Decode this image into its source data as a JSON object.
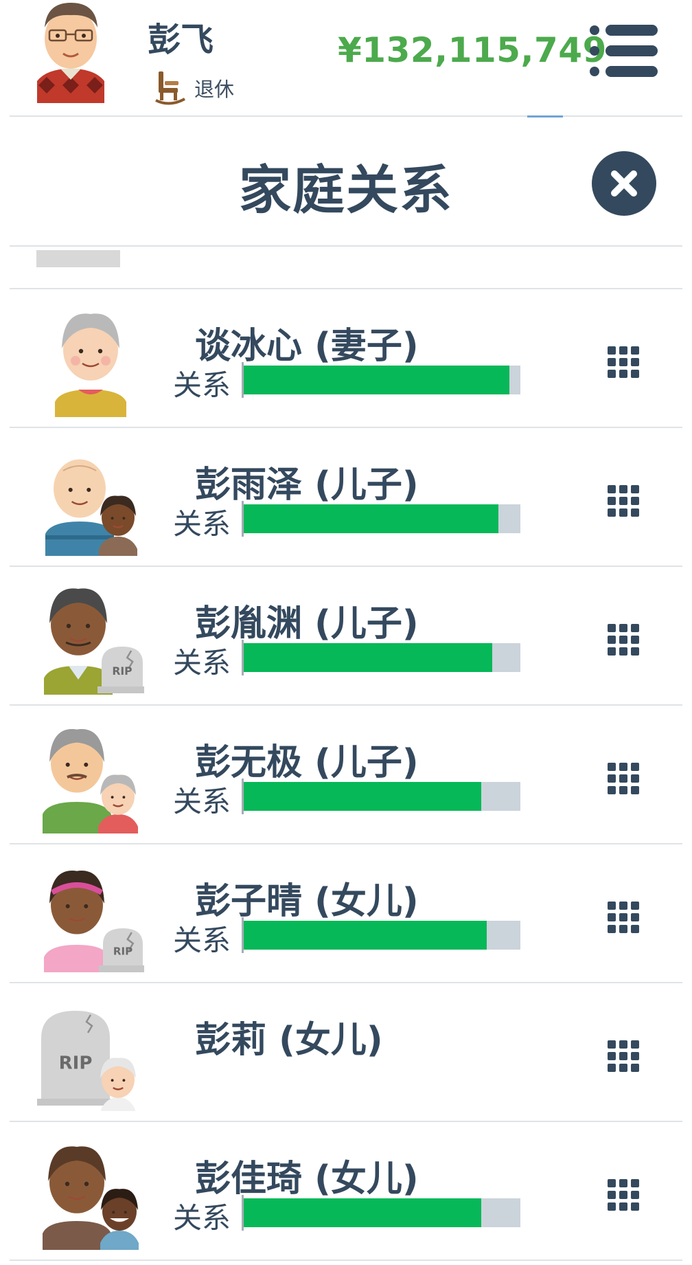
{
  "header": {
    "player_name": "彭飞",
    "status_text": "退休",
    "status_icon": "rocking-chair-icon",
    "money": "¥132,115,749",
    "money_color": "#4caa4c",
    "menu_icon": "menu-list-icon"
  },
  "modal": {
    "title": "家庭关系",
    "close_icon": "close-icon"
  },
  "relationship_label": "关系",
  "family": [
    {
      "name": "谈冰心 (妻子)",
      "relationship": 0.96,
      "deceased": false,
      "portrait": "elderly-woman-avatar"
    },
    {
      "name": "彭雨泽 (儿子)",
      "relationship": 0.92,
      "deceased": false,
      "portrait": "elderly-man-with-child-avatar"
    },
    {
      "name": "彭胤渊 (儿子)",
      "relationship": 0.9,
      "deceased": true,
      "portrait": "elderly-man-rip-avatar"
    },
    {
      "name": "彭无极 (儿子)",
      "relationship": 0.86,
      "deceased": false,
      "portrait": "elderly-man-with-partner-avatar"
    },
    {
      "name": "彭子晴 (女儿)",
      "relationship": 0.88,
      "deceased": true,
      "portrait": "elderly-woman-rip-avatar"
    },
    {
      "name": "彭莉 (女儿)",
      "relationship": null,
      "deceased": true,
      "portrait": "gravestone-rip-avatar"
    },
    {
      "name": "彭佳琦 (女儿)",
      "relationship": 0.86,
      "deceased": false,
      "portrait": "woman-with-partner-avatar"
    }
  ],
  "rip_text": "RIP",
  "row_action_icon": "grid-dots-icon",
  "colors": {
    "text": "#34495e",
    "bar_fill": "#06b858",
    "bar_track": "#cbd3db"
  }
}
